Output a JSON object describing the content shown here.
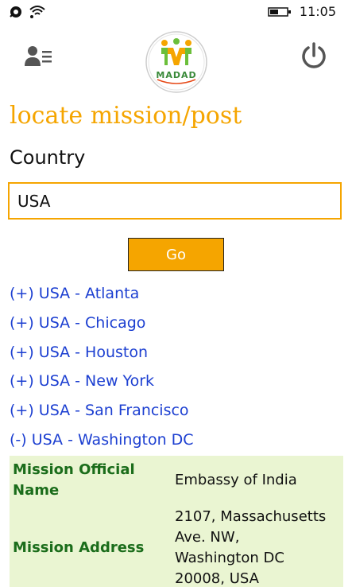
{
  "status_bar": {
    "time": "11:05",
    "icons": [
      "messaging-sync-icon",
      "wifi-icon",
      "battery-icon"
    ]
  },
  "app_bar": {
    "contacts_icon": "contacts-list-icon",
    "logo_text": "MADAD",
    "power_icon": "power-icon"
  },
  "page": {
    "title": "locate mission/post",
    "country_label": "Country",
    "country_value": "USA",
    "go_label": "Go"
  },
  "missions": [
    "(+) USA - Atlanta",
    "(+) USA - Chicago",
    "(+) USA - Houston",
    "(+) USA - New York",
    "(+) USA - San Francisco",
    "(-) USA - Washington DC"
  ],
  "details": {
    "official_name_label": "Mission Official Name",
    "official_name_value": "Embassy of India",
    "address_label": "Mission Address",
    "address_lines": [
      "2107, Massachusetts",
      "Ave. NW,",
      "Washington DC",
      "20008, USA"
    ]
  },
  "colors": {
    "accent": "#f5a500",
    "link": "#1c3fd1",
    "detail_bg": "#eaf5d2",
    "detail_label": "#1b6d1b"
  }
}
